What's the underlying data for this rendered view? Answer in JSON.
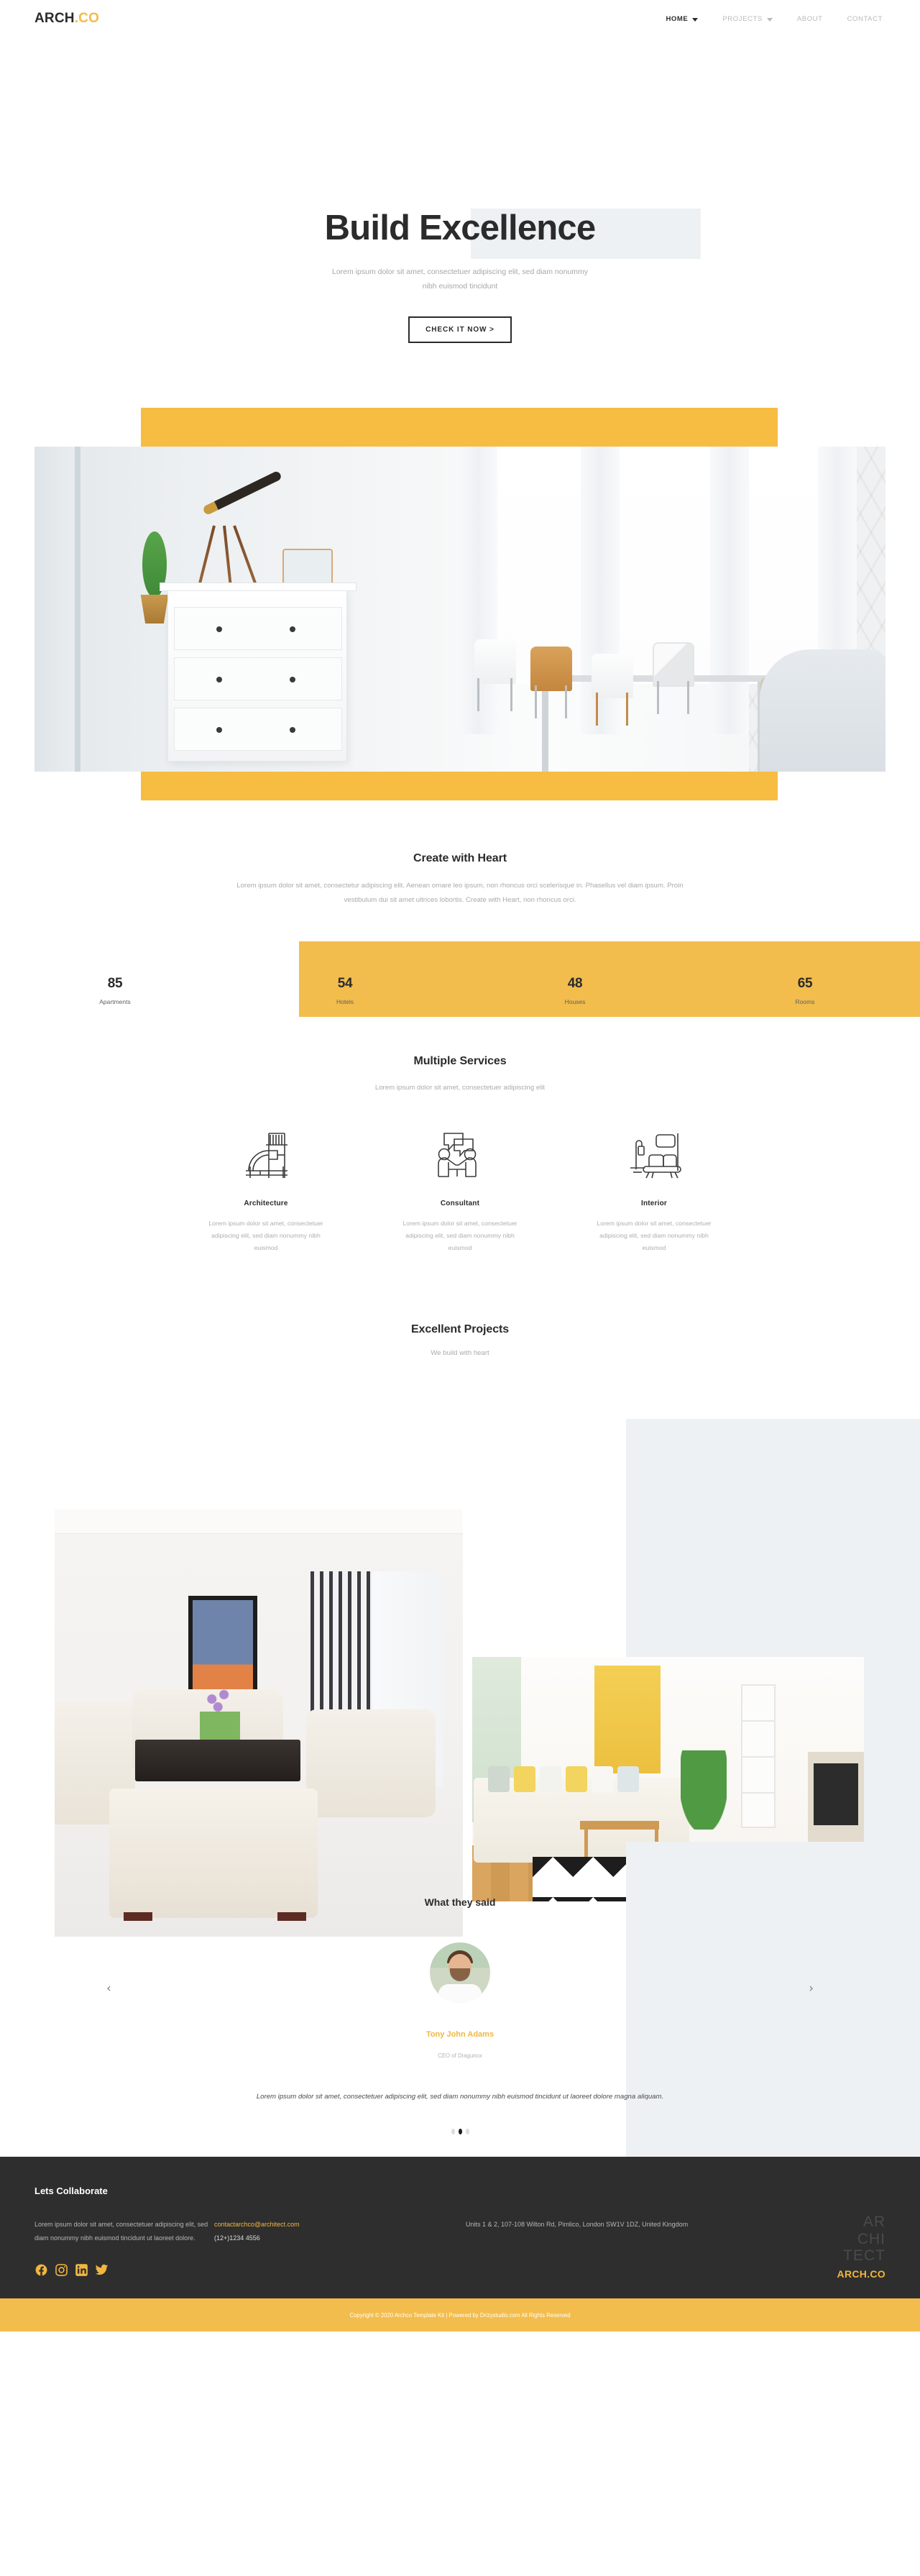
{
  "nav": {
    "logo_main": "ARCH",
    "logo_accent": ".CO",
    "items": [
      {
        "label": "HOME",
        "has_caret": true,
        "active": true
      },
      {
        "label": "PROJECTS",
        "has_caret": true,
        "active": false
      },
      {
        "label": "ABOUT",
        "has_caret": false,
        "active": false
      },
      {
        "label": "CONTACT",
        "has_caret": false,
        "active": false
      }
    ]
  },
  "hero": {
    "title": "Build Excellence",
    "subtitle": "Lorem ipsum dolor sit amet, consectetuer adipiscing elit, sed diam nonummy nibh euismod tincidunt",
    "button": "CHECK IT NOW >"
  },
  "create": {
    "heading": "Create with Heart",
    "paragraph": "Lorem ipsum dolor sit amet, consectetur adipiscing elit. Aenean omare leo ipsum, non rhoncus orci scelerisque in. Phasellus vel diam ipsum. Proin vestibulum dui sit amet ultrices lobortis. Create with Heart, non rhoncus orci."
  },
  "stats": [
    {
      "number": "85",
      "label": "Apartments"
    },
    {
      "number": "54",
      "label": "Hotels"
    },
    {
      "number": "48",
      "label": "Houses"
    },
    {
      "number": "65",
      "label": "Rooms"
    }
  ],
  "services": {
    "heading": "Multiple Services",
    "subheading": "Lorem ipsum dolor sit amet, consectetuer adipiscing elit",
    "items": [
      {
        "icon": "architecture-icon",
        "title": "Architecture",
        "text": "Lorem ipsum dolor sit amet, consectetuer adipiscing elit, sed diam nonummy nibh euismod"
      },
      {
        "icon": "consultant-icon",
        "title": "Consultant",
        "text": "Lorem ipsum dolor sit amet, consectetuer adipiscing elit, sed diam nonummy nibh euismod"
      },
      {
        "icon": "interior-icon",
        "title": "Interior",
        "text": "Lorem ipsum dolor sit amet, consectetuer adipiscing elit, sed diam nonummy nibh euismod"
      }
    ]
  },
  "projects": {
    "heading": "Excellent Projects",
    "subheading": "We build with heart"
  },
  "testimonials": {
    "heading": "What they said",
    "name": "Tony John Adams",
    "role": "CEO of Dragunox",
    "quote": "Lorem ipsum dolor sit amet, consectetuer adipiscing elit, sed diam nonummy nibh euismod tincidunt ut laoreet dolore magna aliquam.",
    "prev_arrow": "‹",
    "next_arrow": "›",
    "dots": 3,
    "active_dot": 1
  },
  "footer": {
    "title": "Lets Collaborate",
    "about": "Lorem ipsum dolor sit amet, consectetuer adipiscing elit, sed diam nonummy nibh euismod tincidunt ut laoreet dolore.",
    "email": "contactarchco@architect.com",
    "phone": "(12+)1234 4556",
    "address": "Units 1 & 2, 107-108 Wilton Rd, Pimlico, London SW1V 1DZ, United Kingdom",
    "watermark_l1": "AR",
    "watermark_l2": "CHI",
    "watermark_l3": "TECT",
    "logo_main": "ARCH",
    "logo_accent": ".CO",
    "socials": [
      "facebook-icon",
      "instagram-icon",
      "linkedin-icon",
      "twitter-icon"
    ],
    "copyright": "Copyright © 2020 Archco Template Kit | Powered by Drizystudio.com All Rights Reserved"
  },
  "colors": {
    "accent_yellow": "#f3bd4d",
    "dark": "#2e2e2e",
    "light_gray_panel": "#eef1f3",
    "muted_text": "#aaaaaa"
  }
}
